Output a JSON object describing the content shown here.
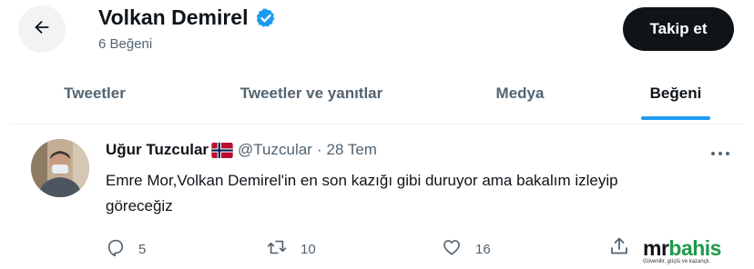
{
  "header": {
    "name": "Volkan Demirel",
    "subtitle": "6 Beğeni",
    "follow_label": "Takip et"
  },
  "tabs": [
    {
      "label": "Tweetler"
    },
    {
      "label": "Tweetler ve yanıtlar"
    },
    {
      "label": "Medya"
    },
    {
      "label": "Beğeni",
      "active": true
    }
  ],
  "tweet": {
    "author_name": "Uğur Tuzcular",
    "handle": "@Tuzcular",
    "separator": "·",
    "date": "28 Tem",
    "text_line1": "Emre Mor,Volkan Demirel'in en son kazığı gibi duruyor ama bakalım izleyip",
    "text_line2": "göreceğiz",
    "reply_count": "5",
    "retweet_count": "10",
    "like_count": "16"
  },
  "watermark": {
    "brand_mr": "mr",
    "brand_bahis": "bahis",
    "tagline": "Güvenilir, güçlü ve kazançlı."
  },
  "colors": {
    "accent": "#1d9bf0",
    "text": "#0f1419",
    "secondary": "#536471",
    "brand_green": "#1f9a4a"
  },
  "icons": [
    "back-arrow-icon",
    "verified-badge-icon",
    "norway-flag-icon",
    "more-icon",
    "reply-icon",
    "retweet-icon",
    "like-icon",
    "share-icon"
  ]
}
